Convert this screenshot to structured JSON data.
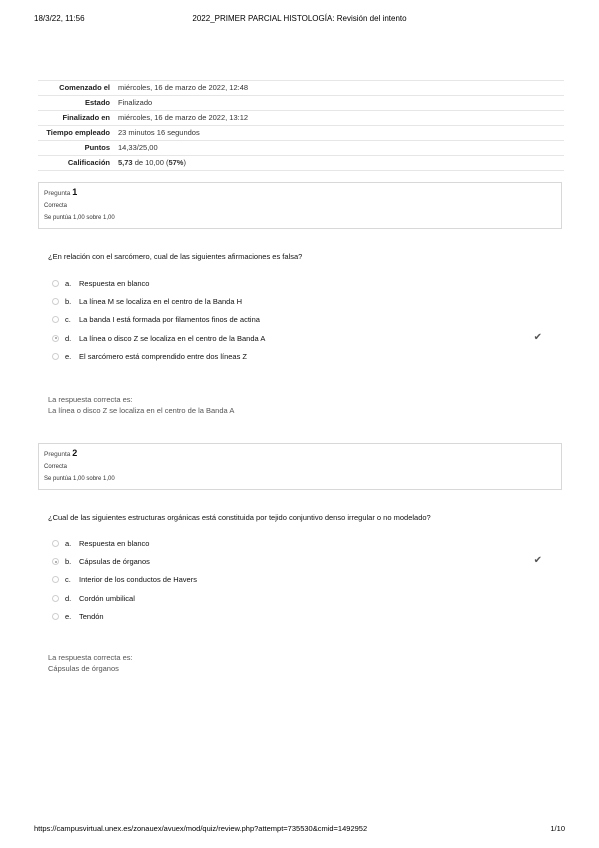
{
  "header": {
    "datetime": "18/3/22, 11:56",
    "title": "2022_PRIMER PARCIAL HISTOLOGÍA: Revisión del intento"
  },
  "summary": [
    {
      "label": "Comenzado el",
      "value": "miércoles, 16 de marzo de 2022, 12:48"
    },
    {
      "label": "Estado",
      "value": "Finalizado"
    },
    {
      "label": "Finalizado en",
      "value": "miércoles, 16 de marzo de 2022, 13:12"
    },
    {
      "label": "Tiempo empleado",
      "value": "23 minutos 16 segundos"
    },
    {
      "label": "Puntos",
      "value": "14,33/25,00"
    },
    {
      "label": "Calificación",
      "value_strong": "5,73",
      "value_mid": " de 10,00 (",
      "value_pct": "57%",
      "value_end": ")"
    }
  ],
  "questions": [
    {
      "number_label": "Pregunta",
      "number": "1",
      "state": "Correcta",
      "grade": "Se puntúa 1,00 sobre 1,00",
      "text": "¿En relación con el sarcómero, cual de las siguientes afirmaciones es falsa?",
      "answers": [
        {
          "letter": "a.",
          "text": "Respuesta en blanco"
        },
        {
          "letter": "b.",
          "text": "La línea M se localiza en el centro de la Banda H"
        },
        {
          "letter": "c.",
          "text": "La banda I está formada por filamentos finos de actina"
        },
        {
          "letter": "d.",
          "text": "La línea o disco Z se localiza en el centro de la Banda A"
        },
        {
          "letter": "e.",
          "text": "El sarcómero está comprendido entre dos líneas Z"
        }
      ],
      "selected_index": 3,
      "feedback_label": "La respuesta correcta es:",
      "feedback_answer": "La línea o disco Z se localiza en el centro de la Banda A"
    },
    {
      "number_label": "Pregunta",
      "number": "2",
      "state": "Correcta",
      "grade": "Se puntúa 1,00 sobre 1,00",
      "text": "¿Cual de las siguientes estructuras orgánicas está constituida por tejido conjuntivo denso irregular o no modelado?",
      "answers": [
        {
          "letter": "a.",
          "text": "Respuesta en blanco"
        },
        {
          "letter": "b.",
          "text": "Cápsulas de órganos"
        },
        {
          "letter": "c.",
          "text": "Interior de los conductos de Havers"
        },
        {
          "letter": "d.",
          "text": "Cordón umbilical"
        },
        {
          "letter": "e.",
          "text": "Tendón"
        }
      ],
      "selected_index": 1,
      "feedback_label": "La respuesta correcta es:",
      "feedback_answer": "Cápsulas de órganos"
    }
  ],
  "footer": {
    "url": "https://campusvirtual.unex.es/zonauex/avuex/mod/quiz/review.php?attempt=735530&cmid=1492952",
    "page": "1/10"
  },
  "icons": {
    "correct": "check-icon",
    "radio": "radio-icon"
  }
}
